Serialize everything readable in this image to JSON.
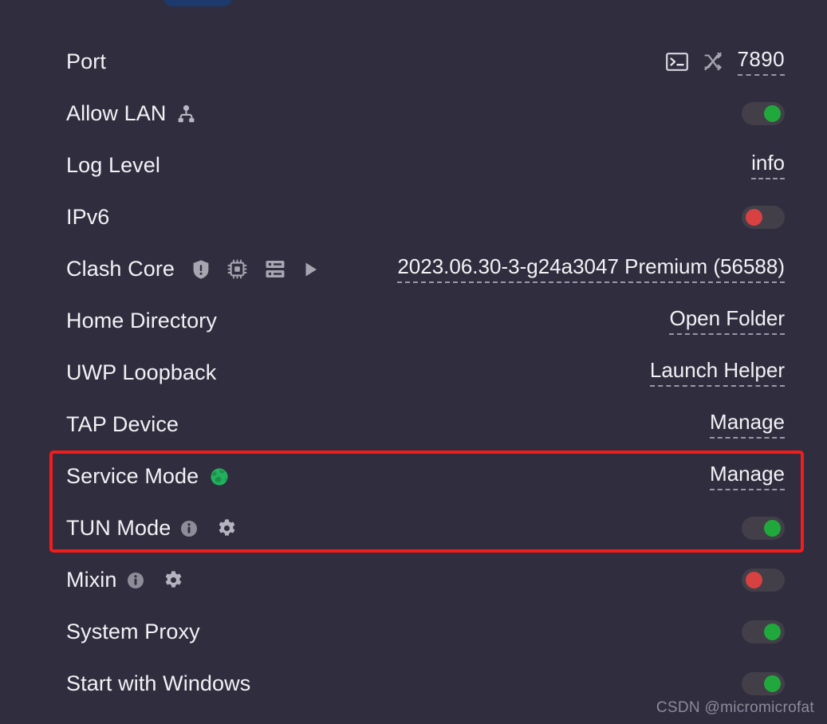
{
  "theme": {
    "background": "#302e3e",
    "text": "#f2f2f5",
    "muted": "#9a98a8",
    "toggle_track": "#423f49",
    "toggle_on": "#21a83c",
    "toggle_off": "#d84141",
    "highlight": "#f51b1b",
    "accent_blue": "#1d3a6e",
    "globe_green": "#22b05e",
    "icon_gray": "#a7a5b0"
  },
  "rows": [
    {
      "label": "Port",
      "icons": [],
      "right_icons": [
        "terminal-icon",
        "shuffle-off-icon"
      ],
      "control": "value",
      "value": "7890"
    },
    {
      "label": "Allow LAN",
      "icons": [
        "network-sitemap-icon"
      ],
      "right_icons": [],
      "control": "toggle",
      "state": "on"
    },
    {
      "label": "Log Level",
      "icons": [],
      "right_icons": [],
      "control": "value",
      "value": "info"
    },
    {
      "label": "IPv6",
      "icons": [],
      "right_icons": [],
      "control": "toggle",
      "state": "off"
    },
    {
      "label": "Clash Core",
      "icons": [
        "shield-alert-icon",
        "cpu-chip-icon",
        "server-icon",
        "play-icon"
      ],
      "right_icons": [],
      "control": "value",
      "value": "2023.06.30-3-g24a3047 Premium (56588)"
    },
    {
      "label": "Home Directory",
      "icons": [],
      "right_icons": [],
      "control": "value",
      "value": "Open Folder"
    },
    {
      "label": "UWP Loopback",
      "icons": [],
      "right_icons": [],
      "control": "value",
      "value": "Launch Helper"
    },
    {
      "label": "TAP Device",
      "icons": [],
      "right_icons": [],
      "control": "value",
      "value": "Manage"
    },
    {
      "label": "Service Mode",
      "icons": [
        "globe-icon"
      ],
      "right_icons": [],
      "control": "value",
      "value": "Manage"
    },
    {
      "label": "TUN Mode",
      "icons": [
        "info-icon",
        "gear-icon"
      ],
      "right_icons": [],
      "control": "toggle",
      "state": "on"
    },
    {
      "label": "Mixin",
      "icons": [
        "info-icon",
        "gear-icon"
      ],
      "right_icons": [],
      "control": "toggle",
      "state": "off"
    },
    {
      "label": "System Proxy",
      "icons": [],
      "right_icons": [],
      "control": "toggle",
      "state": "on"
    },
    {
      "label": "Start with Windows",
      "icons": [],
      "right_icons": [],
      "control": "toggle",
      "state": "on"
    }
  ],
  "annotation": {
    "name": "red-highlight-box",
    "covers": [
      "Service Mode",
      "TUN Mode"
    ]
  },
  "watermark": {
    "text": "CSDN @micromicrofat"
  }
}
